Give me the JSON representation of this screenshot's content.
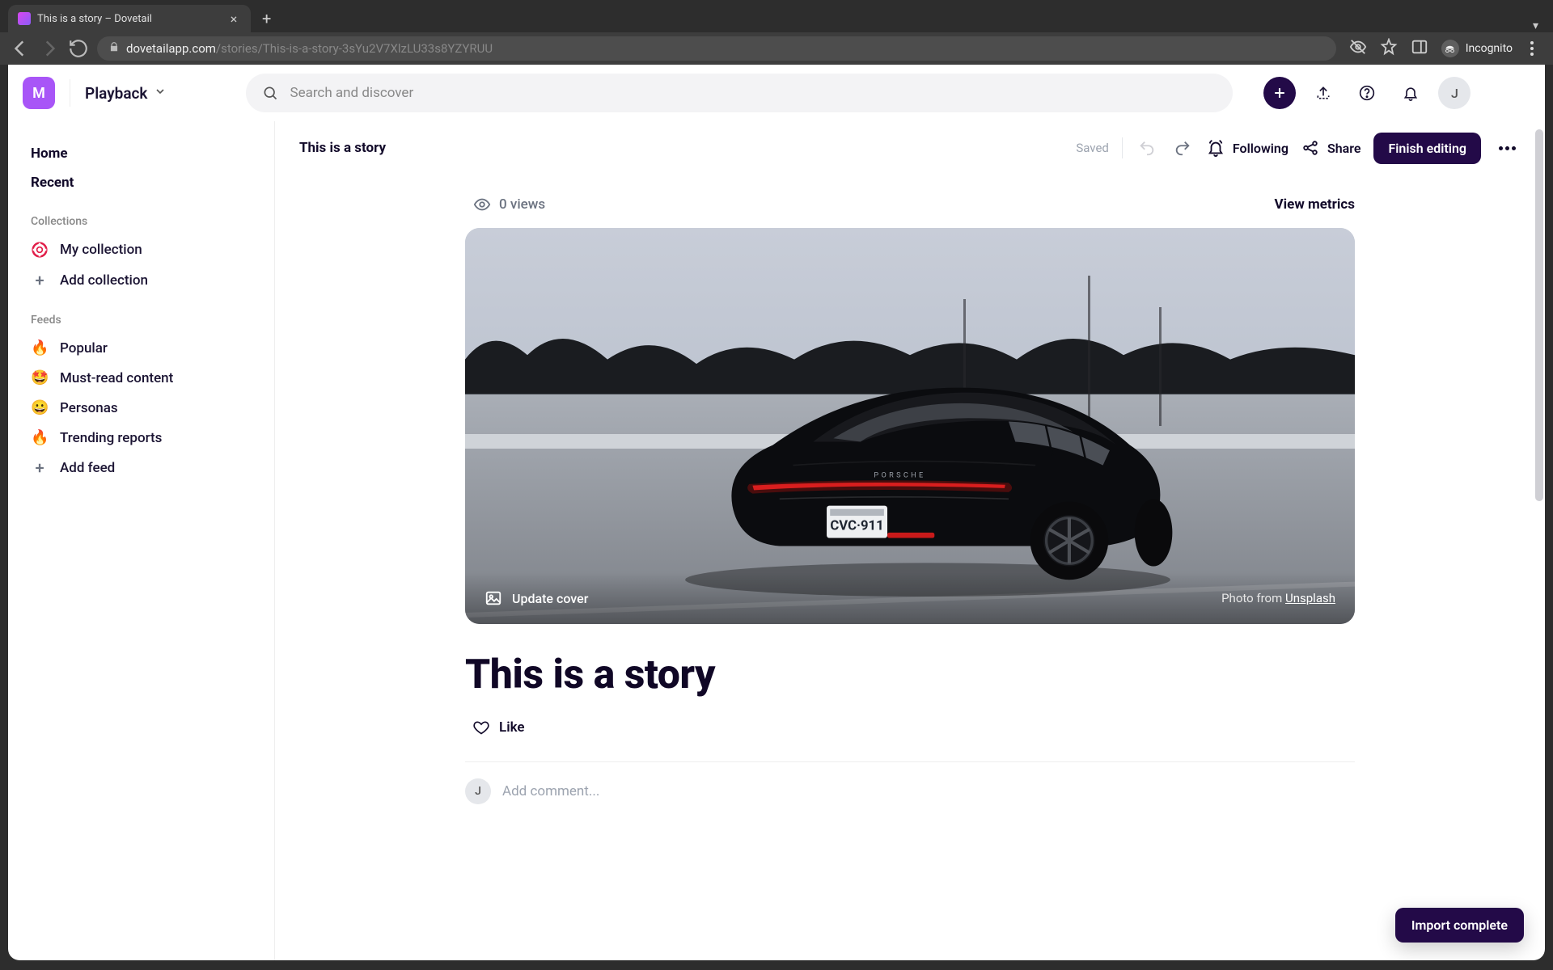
{
  "browser": {
    "tab_title": "This is a story – Dovetail",
    "url_main": "dovetailapp.com",
    "url_rest": "/stories/This-is-a-story-3sYu2V7XlzLU33s8YZYRUU",
    "incognito_label": "Incognito"
  },
  "workspace": {
    "initial": "M",
    "name": "Playback"
  },
  "search": {
    "placeholder": "Search and discover"
  },
  "sidebar": {
    "home": "Home",
    "recent": "Recent",
    "collections_label": "Collections",
    "my_collection": "My collection",
    "add_collection": "Add collection",
    "feeds_label": "Feeds",
    "feeds": {
      "popular": "Popular",
      "must_read": "Must-read content",
      "personas": "Personas",
      "trending": "Trending reports"
    },
    "add_feed": "Add feed"
  },
  "toolbar": {
    "doc_title": "This is a story",
    "saved": "Saved",
    "following": "Following",
    "share": "Share",
    "finish": "Finish editing"
  },
  "metrics": {
    "views": "0 views",
    "view_metrics": "View metrics"
  },
  "cover": {
    "update_label": "Update cover",
    "credit_prefix": "Photo from ",
    "credit_source": "Unsplash"
  },
  "story": {
    "title": "This is a story",
    "like": "Like"
  },
  "comment": {
    "avatar_initial": "J",
    "placeholder": "Add comment..."
  },
  "user": {
    "avatar_initial": "J"
  },
  "toast": {
    "text": "Import complete"
  }
}
